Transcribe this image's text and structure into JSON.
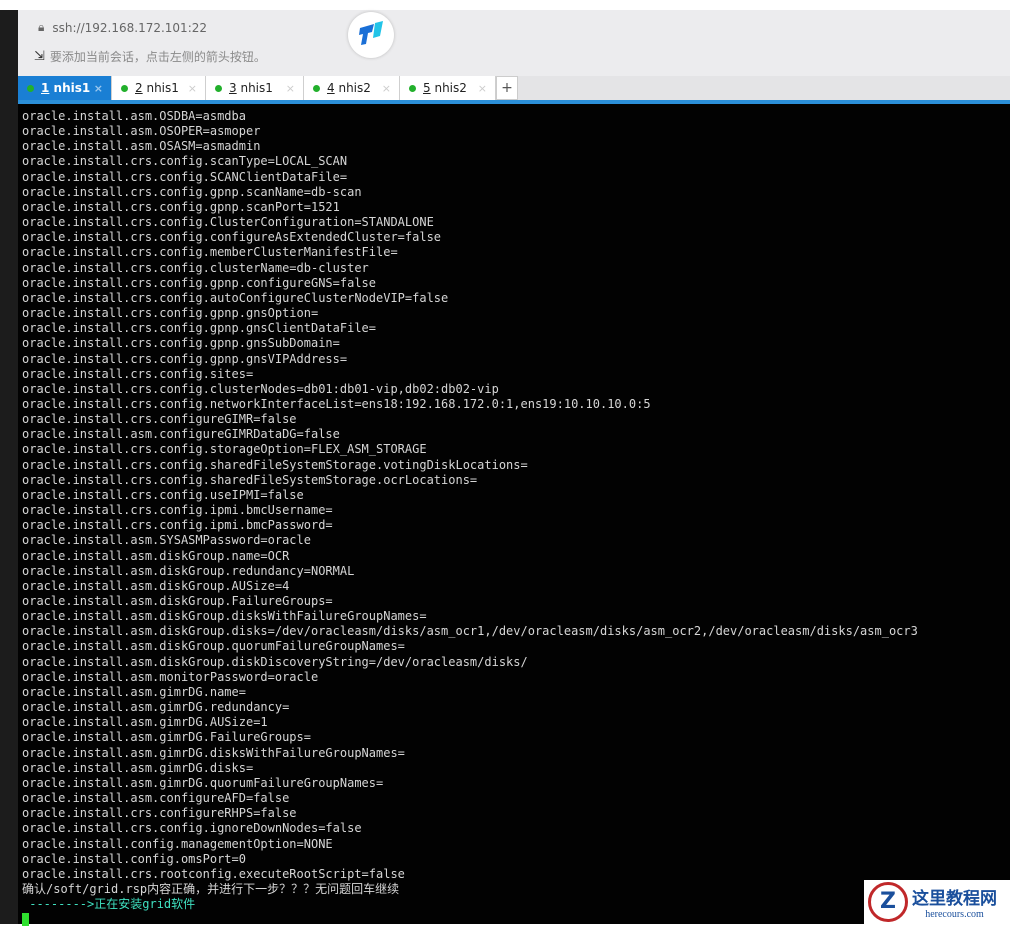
{
  "header": {
    "address": "ssh://192.168.172.101:22",
    "hint": "要添加当前会话，点击左侧的箭头按钮。"
  },
  "tabs": [
    {
      "num": "1",
      "name": "nhis1",
      "active": true
    },
    {
      "num": "2",
      "name": "nhis1"
    },
    {
      "num": "3",
      "name": "nhis1"
    },
    {
      "num": "4",
      "name": "nhis2"
    },
    {
      "num": "5",
      "name": "nhis2"
    }
  ],
  "new_tab_label": "+",
  "terminal": {
    "lines": [
      "oracle.install.asm.OSDBA=asmdba",
      "oracle.install.asm.OSOPER=asmoper",
      "oracle.install.asm.OSASM=asmadmin",
      "oracle.install.crs.config.scanType=LOCAL_SCAN",
      "oracle.install.crs.config.SCANClientDataFile=",
      "oracle.install.crs.config.gpnp.scanName=db-scan",
      "oracle.install.crs.config.gpnp.scanPort=1521",
      "oracle.install.crs.config.ClusterConfiguration=STANDALONE",
      "oracle.install.crs.config.configureAsExtendedCluster=false",
      "oracle.install.crs.config.memberClusterManifestFile=",
      "oracle.install.crs.config.clusterName=db-cluster",
      "oracle.install.crs.config.gpnp.configureGNS=false",
      "oracle.install.crs.config.autoConfigureClusterNodeVIP=false",
      "oracle.install.crs.config.gpnp.gnsOption=",
      "oracle.install.crs.config.gpnp.gnsClientDataFile=",
      "oracle.install.crs.config.gpnp.gnsSubDomain=",
      "oracle.install.crs.config.gpnp.gnsVIPAddress=",
      "oracle.install.crs.config.sites=",
      "oracle.install.crs.config.clusterNodes=db01:db01-vip,db02:db02-vip",
      "oracle.install.crs.config.networkInterfaceList=ens18:192.168.172.0:1,ens19:10.10.10.0:5",
      "oracle.install.crs.configureGIMR=false",
      "oracle.install.asm.configureGIMRDataDG=false",
      "oracle.install.crs.config.storageOption=FLEX_ASM_STORAGE",
      "oracle.install.crs.config.sharedFileSystemStorage.votingDiskLocations=",
      "oracle.install.crs.config.sharedFileSystemStorage.ocrLocations=",
      "oracle.install.crs.config.useIPMI=false",
      "oracle.install.crs.config.ipmi.bmcUsername=",
      "oracle.install.crs.config.ipmi.bmcPassword=",
      "oracle.install.asm.SYSASMPassword=oracle",
      "oracle.install.asm.diskGroup.name=OCR",
      "oracle.install.asm.diskGroup.redundancy=NORMAL",
      "oracle.install.asm.diskGroup.AUSize=4",
      "oracle.install.asm.diskGroup.FailureGroups=",
      "oracle.install.asm.diskGroup.disksWithFailureGroupNames=",
      "oracle.install.asm.diskGroup.disks=/dev/oracleasm/disks/asm_ocr1,/dev/oracleasm/disks/asm_ocr2,/dev/oracleasm/disks/asm_ocr3",
      "oracle.install.asm.diskGroup.quorumFailureGroupNames=",
      "oracle.install.asm.diskGroup.diskDiscoveryString=/dev/oracleasm/disks/",
      "oracle.install.asm.monitorPassword=oracle",
      "oracle.install.asm.gimrDG.name=",
      "oracle.install.asm.gimrDG.redundancy=",
      "oracle.install.asm.gimrDG.AUSize=1",
      "oracle.install.asm.gimrDG.FailureGroups=",
      "oracle.install.asm.gimrDG.disksWithFailureGroupNames=",
      "oracle.install.asm.gimrDG.disks=",
      "oracle.install.asm.gimrDG.quorumFailureGroupNames=",
      "oracle.install.asm.configureAFD=false",
      "oracle.install.crs.configureRHPS=false",
      "oracle.install.crs.config.ignoreDownNodes=false",
      "oracle.install.config.managementOption=NONE",
      "oracle.install.config.omsPort=0",
      "oracle.install.crs.rootconfig.executeRootScript=false",
      "确认/soft/grid.rsp内容正确，并进行下一步？？？无问题回车继续"
    ],
    "status_line": " -------->正在安装grid软件"
  },
  "watermark": {
    "title": "这里教程网",
    "site": "herecours.com"
  }
}
